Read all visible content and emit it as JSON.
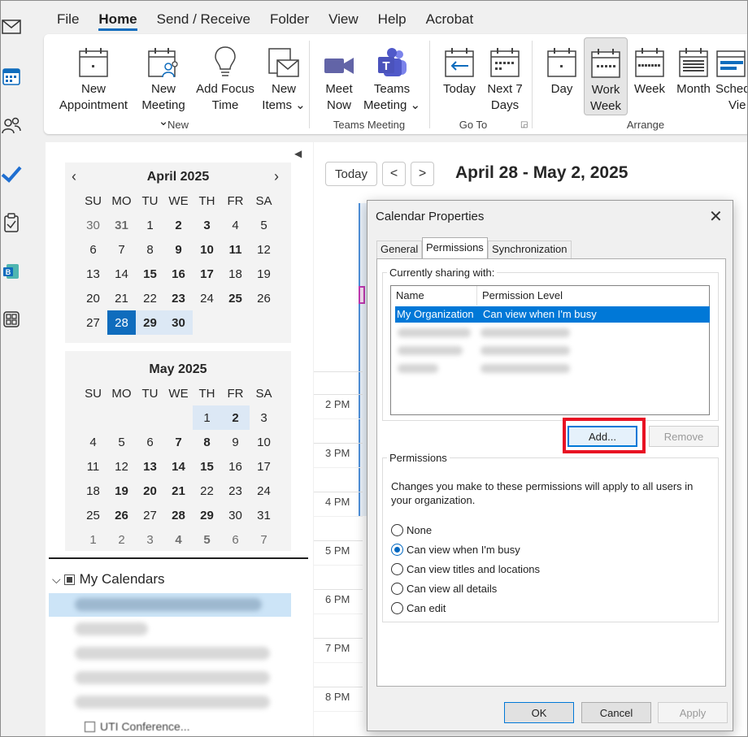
{
  "menu": {
    "tabs": [
      "File",
      "Home",
      "Send / Receive",
      "Folder",
      "View",
      "Help",
      "Acrobat"
    ],
    "active": "Home"
  },
  "ribbon": {
    "new_group": {
      "label": "New",
      "new_appointment": [
        "New",
        "Appointment"
      ],
      "new_meeting": [
        "New",
        "Meeting ⌄"
      ],
      "add_focus_time": [
        "Add Focus",
        "Time"
      ],
      "new_items": [
        "New",
        "Items ⌄"
      ]
    },
    "teams_group": {
      "label": "Teams Meeting",
      "meet_now": [
        "Meet",
        "Now"
      ],
      "teams_meeting": [
        "Teams",
        "Meeting ⌄"
      ]
    },
    "goto_group": {
      "label": "Go To",
      "today": "Today",
      "next7": [
        "Next 7",
        "Days"
      ]
    },
    "arrange_group": {
      "label": "Arrange",
      "day": "Day",
      "work_week": [
        "Work",
        "Week"
      ],
      "week": "Week",
      "month": "Month",
      "schedule": [
        "Sched",
        "Vie"
      ]
    }
  },
  "nav": {
    "april": {
      "title": "April 2025"
    },
    "may": {
      "title": "May 2025"
    },
    "weekdays": [
      "SU",
      "MO",
      "TU",
      "WE",
      "TH",
      "FR",
      "SA"
    ],
    "my_calendars": "My Calendars",
    "last_item": "UTI Conference..."
  },
  "calendar": {
    "today_button": "Today",
    "date_range": "April 28 - May 2, 2025",
    "hours": [
      "2 PM",
      "3 PM",
      "4 PM",
      "5 PM",
      "6 PM",
      "7 PM",
      "8 PM"
    ]
  },
  "dialog": {
    "title": "Calendar Properties",
    "tabs": [
      "General",
      "Permissions",
      "Synchronization"
    ],
    "sharing_legend": "Currently sharing with:",
    "col_name": "Name",
    "col_permission": "Permission Level",
    "selected_name": "My Organization",
    "selected_permission": "Can view when I'm busy",
    "add_button": "Add...",
    "remove_button": "Remove",
    "permissions_legend": "Permissions",
    "permissions_note": "Changes you make to these permissions will apply to all users in your organization.",
    "options": [
      "None",
      "Can view when I'm busy",
      "Can view titles and locations",
      "Can view all details",
      "Can edit"
    ],
    "selected_option": "Can view when I'm busy",
    "ok": "OK",
    "cancel": "Cancel",
    "apply": "Apply"
  }
}
